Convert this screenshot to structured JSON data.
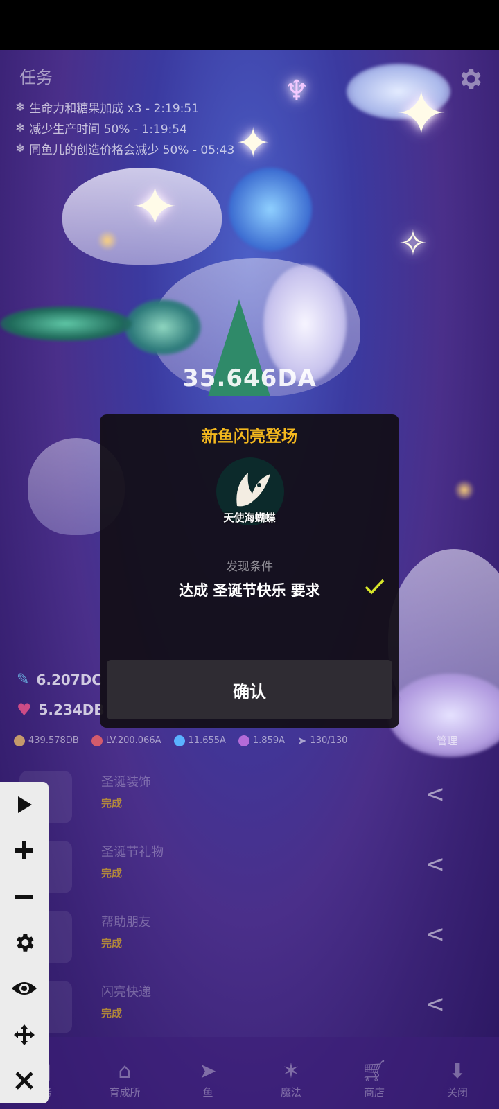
{
  "tasks_panel": {
    "title": "任务",
    "buffs": [
      {
        "text": "生命力和糖果加成 x3 - 2:19:51"
      },
      {
        "text": "减少生产时间 50% - 1:19:54"
      },
      {
        "text": "同鱼儿的创造价格会减少 50% - 05:43"
      }
    ]
  },
  "scene": {
    "vitality_amount": "35.646DA"
  },
  "stats": {
    "gems": "6.207DC",
    "hearts": "5.234DB"
  },
  "resources": {
    "items": [
      {
        "icon": "pickaxe-icon",
        "value": "439.578DB"
      },
      {
        "icon": "crab-icon",
        "value": "LV.200.066A"
      },
      {
        "icon": "diamond-icon",
        "value": "11.655A"
      },
      {
        "icon": "orb-icon",
        "value": "1.859A"
      },
      {
        "icon": "fish-count-icon",
        "value": "130/130"
      }
    ],
    "manage_label": "管理"
  },
  "task_list": [
    {
      "name": "圣诞装饰",
      "state": "完成"
    },
    {
      "name": "圣诞节礼物",
      "state": "完成"
    },
    {
      "name": "帮助朋友",
      "state": "完成"
    },
    {
      "name": "闪亮快递",
      "state": "完成"
    }
  ],
  "bottom_nav": [
    {
      "label": "任务",
      "icon": "tasks-icon"
    },
    {
      "label": "育成所",
      "icon": "hatchery-icon"
    },
    {
      "label": "鱼",
      "icon": "fish-icon"
    },
    {
      "label": "魔法",
      "icon": "magic-icon"
    },
    {
      "label": "商店",
      "icon": "shop-icon"
    },
    {
      "label": "关闭",
      "icon": "close-nav-icon"
    }
  ],
  "modal": {
    "title": "新鱼闪亮登场",
    "fish_name": "天使海蝴蝶",
    "condition_label": "发现条件",
    "condition_text": "达成 圣诞节快乐 要求",
    "confirm_label": "确认"
  },
  "colors": {
    "modal_title": "#f4b81e",
    "check": "#d8e62a",
    "state_gold": "#d6a826"
  }
}
